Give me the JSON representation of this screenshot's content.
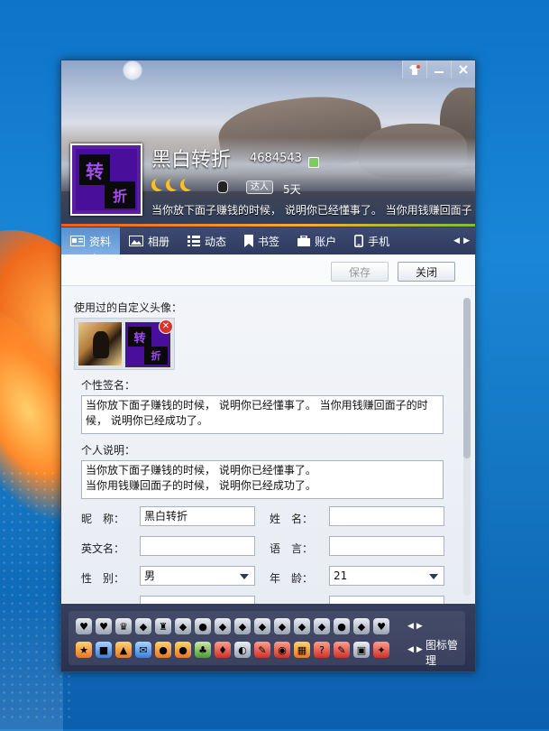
{
  "window": {
    "nickname": "黑白转折",
    "qq_number": "4684543",
    "talent_label": "达人",
    "days": "5天",
    "signature_line": "当你放下面子赚钱的时候， 说明你已经懂事了。 当你用钱赚回面子的",
    "avatar_chars": [
      "转",
      "折"
    ]
  },
  "tabs": [
    {
      "label": "资料"
    },
    {
      "label": "相册"
    },
    {
      "label": "动态"
    },
    {
      "label": "书签"
    },
    {
      "label": "账户"
    },
    {
      "label": "手机"
    }
  ],
  "toolbar": {
    "save_label": "保存",
    "close_label": "关闭"
  },
  "form": {
    "custom_avatar_label": "使用过的自定义头像：",
    "signature_label": "个性签名：",
    "signature_value": "当你放下面子赚钱的时候， 说明你已经懂事了。 当你用钱赚回面子的时候， 说明你已经成功了。",
    "desc_label": "个人说明：",
    "desc_line1": "当你放下面子赚钱的时候， 说明你已经懂事了。",
    "desc_line2": "当你用钱赚回面子的时候， 说明你已经成功了。",
    "nick_label": "昵　称：",
    "nick_value": "黑白转折",
    "name_label": "姓　名：",
    "name_value": "",
    "eng_label": "英文名：",
    "eng_value": "",
    "lang_label": "语　言：",
    "lang_value": "",
    "gender_label": "性　别：",
    "gender_value": "男",
    "age_label": "年　龄：",
    "age_value": "21"
  },
  "bottom": {
    "manage_label": "图标管理"
  }
}
